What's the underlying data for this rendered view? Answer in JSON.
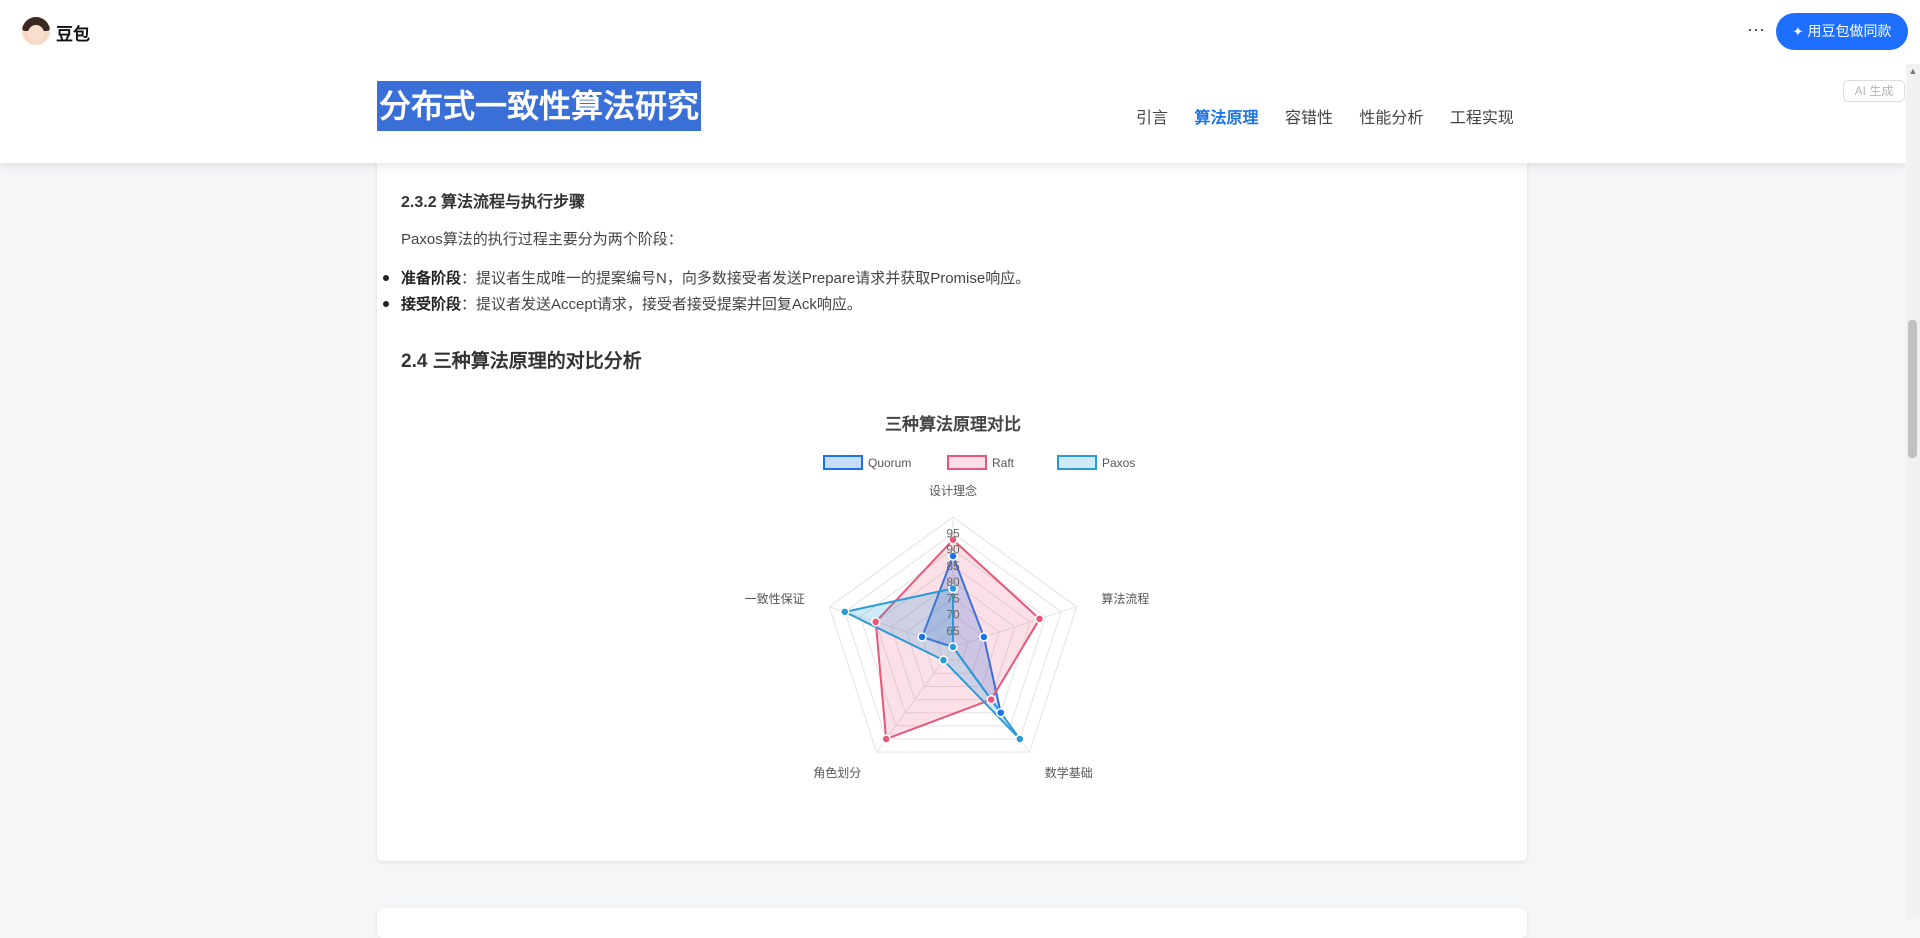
{
  "app": {
    "name": "豆包"
  },
  "toolbar": {
    "more_label": "···",
    "make_same_label": "用豆包做同款"
  },
  "document": {
    "title": "分布式一致性算法研究",
    "ai_badge": "AI 生成",
    "nav": [
      {
        "label": "引言",
        "active": false
      },
      {
        "label": "算法原理",
        "active": true
      },
      {
        "label": "容错性",
        "active": false
      },
      {
        "label": "性能分析",
        "active": false
      },
      {
        "label": "工程实现",
        "active": false
      }
    ]
  },
  "content": {
    "section_heading": "2.3.2 算法流程与执行步骤",
    "intro": "Paxos算法的执行过程主要分为两个阶段：",
    "bullets": [
      {
        "term": "准备阶段",
        "text": "：提议者生成唯一的提案编号N，向多数接受者发送Prepare请求并获取Promise响应。"
      },
      {
        "term": "接受阶段",
        "text": "：提议者发送Accept请求，接受者接受提案并回复Ack响应。"
      }
    ],
    "compare_heading": "2.4 三种算法原理的对比分析"
  },
  "chart_data": {
    "type": "radar",
    "title": "三种算法原理对比",
    "axes": [
      "设计理念",
      "算法流程",
      "数学基础",
      "角色划分",
      "一致性保证"
    ],
    "radial_min": 60,
    "radial_max": 100,
    "ticks": [
      65,
      70,
      75,
      80,
      85,
      90,
      95
    ],
    "legend_position": "top",
    "series": [
      {
        "name": "Quorum",
        "values": [
          88,
          70,
          85,
          60,
          70
        ],
        "color": "#1a73e8",
        "fill": "rgba(26,115,232,0.25)"
      },
      {
        "name": "Raft",
        "values": [
          93,
          88,
          80,
          95,
          85
        ],
        "color": "#e8567a",
        "fill": "rgba(232,86,122,0.18)"
      },
      {
        "name": "Paxos",
        "values": [
          78,
          60,
          95,
          65,
          95
        ],
        "color": "#2a9bd8",
        "fill": "rgba(42,155,216,0.22)"
      }
    ]
  }
}
